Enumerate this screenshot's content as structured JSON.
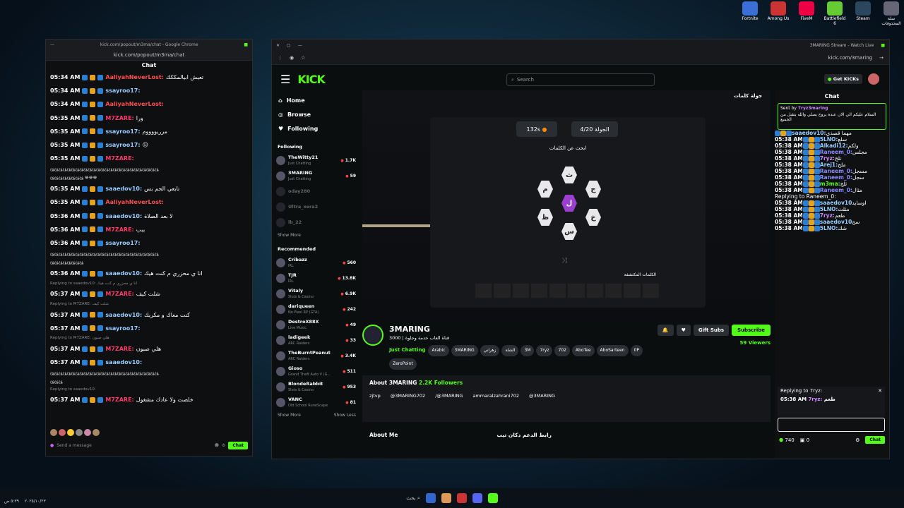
{
  "desktop": {
    "icons": [
      {
        "label": "Fortnite",
        "color": "#3a6fd8"
      },
      {
        "label": "Among Us",
        "color": "#c33"
      },
      {
        "label": "FiveM",
        "color": "#e04"
      },
      {
        "label": "Battlefield 6",
        "color": "#6c3"
      },
      {
        "label": "Steam",
        "color": "#2a475e"
      },
      {
        "label": "سلة المحذوفات",
        "color": "#667"
      }
    ]
  },
  "popup": {
    "title": "kick.com/popout/m3ma/chat - Google Chrome",
    "url": "kick.com/popout/m3ma/chat",
    "chat_title": "Chat",
    "send_placeholder": "Send a message",
    "chat_button": "Chat",
    "messages": [
      {
        "t": "05:34 AM",
        "u": "AaliyahNeverLost:",
        "c": "#ff4f4f",
        "m": "تعيش ابيالمككك"
      },
      {
        "t": "05:34 AM",
        "u": "ssayroo17:",
        "c": "#9cf",
        "m": ""
      },
      {
        "t": "05:34 AM",
        "u": "AaliyahNeverLost:",
        "c": "#ff4f4f",
        "m": ""
      },
      {
        "t": "05:35 AM",
        "u": "M7ZARE:",
        "c": "#ff3b6b",
        "m": "ورا"
      },
      {
        "t": "05:35 AM",
        "u": "ssayroo17:",
        "c": "#9cf",
        "m": "مرريووووم"
      },
      {
        "t": "05:35 AM",
        "u": "ssayroo17:",
        "c": "#9cf",
        "m": "😐"
      },
      {
        "t": "05:35 AM",
        "u": "M7ZARE:",
        "c": "#ff3b6b",
        "m": ""
      },
      {
        "t": "",
        "u": "",
        "c": "",
        "m": "ع؏ع؏ع؏ع؏ع؏ع؏ع؏ع؏ع؏ع؏ع؏ع؏ع؏ع؏ع؏ع؏ع؏ع؏ع؏ع؏ع؏ع؏ع؏ع؏ع؏ع؏",
        "wrap": true
      },
      {
        "t": "",
        "u": "",
        "c": "",
        "m": "ع؏ع؏ع؏ع؏ع؏ع؏ع؏ع؏ 😂😂😂",
        "wrap": true
      },
      {
        "t": "05:35 AM",
        "u": "saaedov10:",
        "c": "#9cf",
        "m": "تابعي الجم بس"
      },
      {
        "t": "05:35 AM",
        "u": "AaliyahNeverLost:",
        "c": "#ff4f4f",
        "m": ""
      },
      {
        "t": "05:36 AM",
        "u": "saaedov10:",
        "c": "#9cf",
        "m": "لا بعد الصلاة"
      },
      {
        "t": "05:36 AM",
        "u": "M7ZARE:",
        "c": "#ff3b6b",
        "m": "ببب"
      },
      {
        "t": "05:36 AM",
        "u": "ssayroo17:",
        "c": "#9cf",
        "m": ""
      },
      {
        "t": "",
        "u": "",
        "c": "",
        "m": "ع؏ع؏ع؏ع؏ع؏ع؏ع؏ع؏ع؏ع؏ع؏ع؏ع؏ع؏ع؏ع؏ع؏ع؏ع؏ع؏ع؏ع؏ع؏ع؏ع؏ع؏",
        "wrap": true
      },
      {
        "t": "",
        "u": "",
        "c": "",
        "m": "ع؏ع؏ع؏ع؏ع؏ع؏ع؏ع؏",
        "wrap": true
      },
      {
        "t": "05:36 AM",
        "u": "saaedov10:",
        "c": "#9cf",
        "m": "انا ي محزري م كنت هيك"
      },
      {
        "t": "",
        "u": "",
        "c": "",
        "m": "Replying to saaedov10: انا ي محزري م كنت هيك",
        "rep": true
      },
      {
        "t": "05:37 AM",
        "u": "M7ZARE:",
        "c": "#ff3b6b",
        "m": "شلت كيف"
      },
      {
        "t": "",
        "u": "",
        "c": "",
        "m": "Replying to M7ZARE: شلت كيف",
        "rep": true
      },
      {
        "t": "05:37 AM",
        "u": "saaedov10:",
        "c": "#9cf",
        "m": "كنت معاك و مكربك"
      },
      {
        "t": "05:37 AM",
        "u": "ssayroo17:",
        "c": "#9cf",
        "m": ""
      },
      {
        "t": "",
        "u": "",
        "c": "",
        "m": "Replying to M7ZARE: هلي صبون",
        "rep": true
      },
      {
        "t": "05:37 AM",
        "u": "M7ZARE:",
        "c": "#ff3b6b",
        "m": "هلي صبون"
      },
      {
        "t": "05:37 AM",
        "u": "saaedov10:",
        "c": "#9cf",
        "m": ""
      },
      {
        "t": "",
        "u": "",
        "c": "",
        "m": "ع؏ع؏ع؏ع؏ع؏ع؏ع؏ع؏ع؏ع؏ع؏ع؏ع؏ع؏ع؏ع؏ع؏ع؏ع؏ع؏ع؏ع؏ع؏ع؏ع؏ع؏",
        "wrap": true
      },
      {
        "t": "",
        "u": "",
        "c": "",
        "m": "ع؏ع؏ع؏",
        "wrap": true
      },
      {
        "t": "",
        "u": "",
        "c": "",
        "m": "Replying to saaedov10:",
        "rep": true
      },
      {
        "t": "05:37 AM",
        "u": "M7ZARE:",
        "c": "#ff3b6b",
        "m": "خلصت ولا عادك مشغول"
      }
    ]
  },
  "main": {
    "title": "3MARING Stream - Watch Live",
    "url": "kick.com/3maring",
    "search_placeholder": "Search",
    "get_kicks": "Get KICKs",
    "nav": [
      "Home",
      "Browse",
      "Following"
    ],
    "following_title": "Following",
    "following": [
      {
        "n": "TheWitty21",
        "s": "Just Chatting",
        "v": "1.7K"
      },
      {
        "n": "3MARING",
        "s": "Just Chatting",
        "v": "59"
      },
      {
        "n": "oday280",
        "s": "",
        "v": "",
        "off": true
      },
      {
        "n": "Ultra_xera2",
        "s": "",
        "v": "",
        "off": true
      },
      {
        "n": "lb_22",
        "s": "",
        "v": "",
        "off": true
      }
    ],
    "show_more": "Show More",
    "recommended_title": "Recommended",
    "recommended": [
      {
        "n": "Cribazz",
        "s": "IRL",
        "v": "560"
      },
      {
        "n": "TJR",
        "s": "IRL",
        "v": "13.8K"
      },
      {
        "n": "Vitaly",
        "s": "Slots & Casino",
        "v": "6.9K"
      },
      {
        "n": "dariqueen",
        "s": "No Pixel RP (GTA)",
        "v": "242"
      },
      {
        "n": "DestroX88X",
        "s": "Live Music",
        "v": "49"
      },
      {
        "n": "ladigeek",
        "s": "ARC Raiders",
        "v": "33"
      },
      {
        "n": "TheBurntPeanut",
        "s": "ARC Raiders",
        "v": "3.4K"
      },
      {
        "n": "Gioso",
        "s": "Grand Theft Auto V (G...",
        "v": "511"
      },
      {
        "n": "BlondeRabbit",
        "s": "Slots & Casino",
        "v": "953"
      },
      {
        "n": "VANC",
        "s": "Old School RuneScape",
        "v": "81"
      }
    ],
    "show_less": "Show Less",
    "game": {
      "header": "جولة كلمات",
      "round": "الجولة 4/20",
      "timer": "132s",
      "find": "ابحث عن الكلمات",
      "letters": [
        "ث",
        "ج",
        "م",
        "ل",
        "خ",
        "ظ",
        "س"
      ],
      "found_title": "الكلمات المكتشفة"
    },
    "channel": {
      "name": "3MARING",
      "title": "قناة العاب خدمة وجلوة | 3000",
      "category": "Just Chatting",
      "tags": [
        "Arabic",
        "3MARING",
        "زهراني",
        "الشلة",
        "3M",
        "7ryz",
        "702",
        "AboTee",
        "AboSarteen",
        "0P",
        "ZeroPoint"
      ],
      "viewers": "59 Viewers",
      "gift": "Gift Subs",
      "subscribe": "Subscribe",
      "about": "About 3MARING",
      "followers": "2.2K Followers",
      "socials": [
        "zjtvp",
        "@3MARING702",
        "/@3MARING",
        "ammaralzahrani702",
        "@3MARING"
      ],
      "about_me": "About Me",
      "link": "رابط الدعم دكان تيب"
    }
  },
  "rchat": {
    "title": "Chat",
    "pinned_by": "Sent by",
    "pinned_user": "7ryz3maring",
    "pinned_msg": "السلام عليكم الي الان عنده يروح يصلي والله يتقبل من الجميع",
    "send": "Chat",
    "points": "740",
    "count": "0",
    "reply_to": "Replying to 7ryz:",
    "messages": [
      {
        "t": "",
        "u": "saaedov10:",
        "c": "#9cf",
        "m": "مهما قصدي"
      },
      {
        "t": "05:38 AM",
        "u": "5LNO:",
        "c": "#9cf",
        "m": "سلع"
      },
      {
        "t": "05:38 AM",
        "u": "Alkadi12:",
        "c": "#9cf",
        "m": "ولكم"
      },
      {
        "t": "05:38 AM",
        "u": "Raneem_0:",
        "c": "#8a8aff",
        "m": "مجلس"
      },
      {
        "t": "05:38 AM",
        "u": "7ryz:",
        "c": "#c8f",
        "m": "تلج"
      },
      {
        "t": "05:38 AM",
        "u": "Arej1:",
        "c": "#9cf",
        "m": "ملح"
      },
      {
        "t": "05:38 AM",
        "u": "Raneem_0:",
        "c": "#8a8aff",
        "m": "مسجل"
      },
      {
        "t": "05:38 AM",
        "u": "Raneem_0:",
        "c": "#8a8aff",
        "m": "سجل"
      },
      {
        "t": "05:38 AM",
        "u": "m3ma:",
        "c": "#53fc18",
        "m": "ثلج"
      },
      {
        "t": "05:38 AM",
        "u": "Raneem_0:",
        "c": "#8a8aff",
        "m": "مثال"
      },
      {
        "t": "",
        "u": "",
        "c": "",
        "m": "Replying to Raneem_0:",
        "rep": true
      },
      {
        "t": "05:38 AM",
        "u": "saaedov10",
        "c": "#9cf",
        "m": "اوسايد"
      },
      {
        "t": "05:38 AM",
        "u": "5LNO:",
        "c": "#9cf",
        "m": "مثلث"
      },
      {
        "t": "05:38 AM",
        "u": "7ryz:",
        "c": "#c8f",
        "m": "طعم"
      },
      {
        "t": "05:38 AM",
        "u": "saaedov10",
        "c": "#9cf",
        "m": "سح"
      },
      {
        "t": "05:38 AM",
        "u": "5LNO:",
        "c": "#9cf",
        "m": "شك"
      }
    ]
  },
  "taskbar": {
    "search": "بحث",
    "time": "٥:٣٩ ص",
    "date": "٢٠٢٥/١٠/٢٣"
  }
}
